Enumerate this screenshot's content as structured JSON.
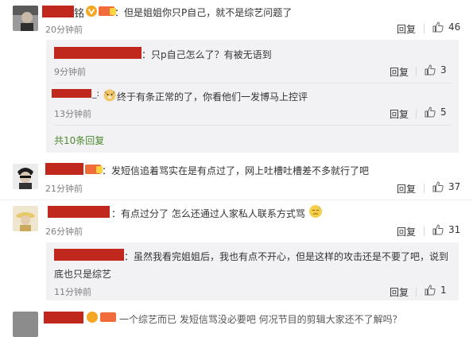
{
  "comments": [
    {
      "name_visible": "铭",
      "text": "：但是姐姐你只P自己，就不是综艺问题了",
      "time": "20分钟前",
      "reply_label": "回复",
      "likes": "46",
      "replies": [
        {
          "text": "：只p自己怎么了？有被无语到",
          "time": "9分钟前",
          "reply_label": "回复",
          "likes": "3"
        },
        {
          "text": "终于有条正常的了，你看他们一发博马上控评",
          "time": "13分钟前",
          "reply_label": "回复",
          "likes": "5"
        }
      ],
      "more_replies": "共10条回复"
    },
    {
      "text": "：发短信追着骂实在是有点过了，网上吐槽吐槽差不多就行了吧",
      "time": "21分钟前",
      "reply_label": "回复",
      "likes": "37"
    },
    {
      "text": "：有点过分了  怎么还通过人家私人联系方式骂",
      "time": "26分钟前",
      "reply_label": "回复",
      "likes": "31",
      "replies": [
        {
          "text_line1": "：虽然我看完姐姐后，我也有点不开心，但是这样的攻击还是不要了吧，说到",
          "text_line2": "底也只是综艺",
          "time": "11分钟前",
          "reply_label": "回复",
          "likes": "1"
        }
      ]
    }
  ],
  "partial_comment": {
    "text": "一个综艺而已  发短信骂没必要吧  何况节目的剪辑大家还不了解吗？"
  },
  "colors": {
    "redact": "#c0281d",
    "link_green": "#4c8a2f",
    "box_bg": "#f2f2f5"
  }
}
